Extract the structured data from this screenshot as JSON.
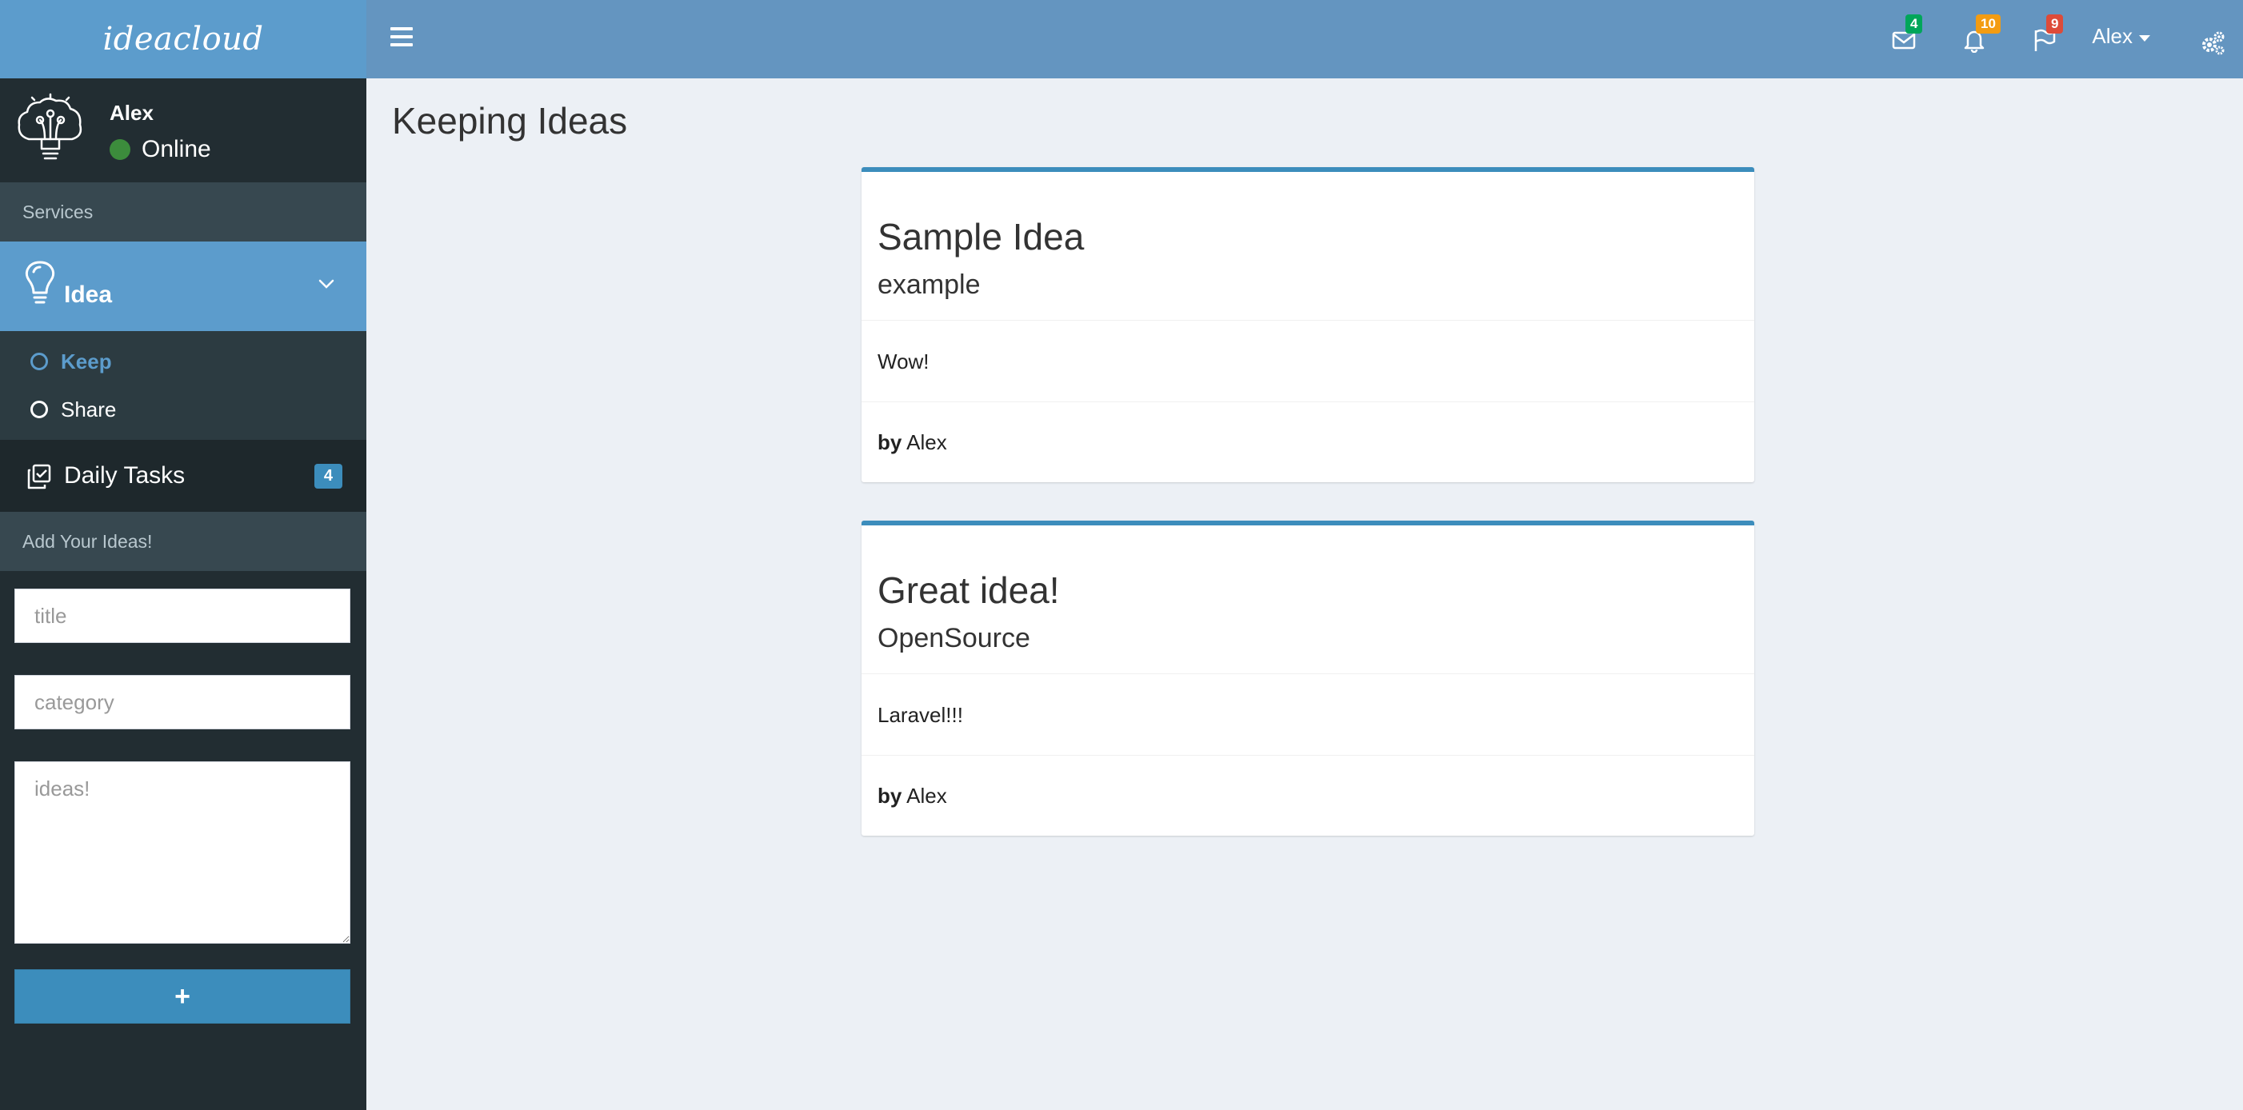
{
  "app": {
    "logo": "ideacloud"
  },
  "header": {
    "messages_count": "4",
    "notifications_count": "10",
    "flags_count": "9",
    "user_name": "Alex"
  },
  "sidebar": {
    "user": {
      "name": "Alex",
      "status": "Online"
    },
    "section_services": "Services",
    "idea_menu": {
      "label": "Idea",
      "items": [
        {
          "label": "Keep"
        },
        {
          "label": "Share"
        }
      ]
    },
    "daily_tasks": {
      "label": "Daily Tasks",
      "count": "4"
    },
    "section_add": "Add Your Ideas!",
    "form": {
      "title_placeholder": "title",
      "category_placeholder": "category",
      "ideas_placeholder": "ideas!",
      "add_label": "+"
    }
  },
  "main": {
    "page_title": "Keeping Ideas",
    "cards": [
      {
        "title": "Sample Idea",
        "category": "example",
        "body": "Wow!",
        "by_label": "by",
        "author": "Alex"
      },
      {
        "title": "Great idea!",
        "category": "OpenSource",
        "body": "Laravel!!!",
        "by_label": "by",
        "author": "Alex"
      }
    ]
  },
  "colors": {
    "logo_bg": "#5c9ccc",
    "topbar_bg": "#6495c0",
    "sidebar_bg": "#222d32",
    "accent": "#3c8dbc",
    "content_bg": "#ecf0f5"
  }
}
